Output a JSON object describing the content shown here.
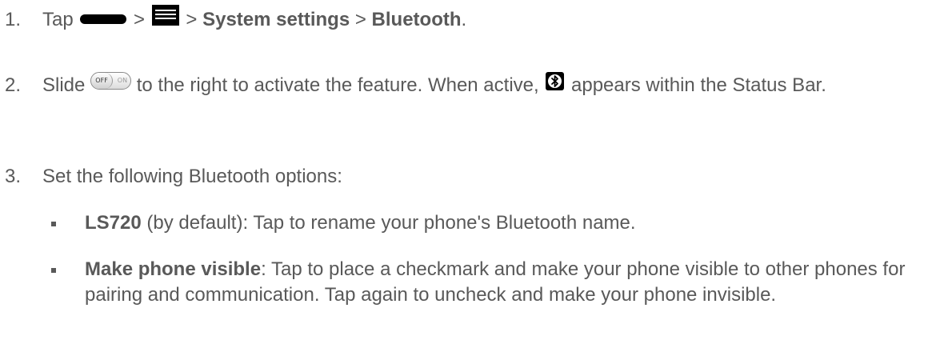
{
  "steps": [
    {
      "number": "1.",
      "tap": "Tap",
      "sep1": ">",
      "sep2": ">",
      "system_settings": "System settings",
      "sep3": ">",
      "bluetooth": "Bluetooth",
      "end": "."
    },
    {
      "number": "2.",
      "slide": "Slide",
      "after_toggle": "to the right to activate the feature. When active,",
      "after_icon": "appears within the Status Bar."
    },
    {
      "number": "3.",
      "text": "Set the following Bluetooth options:"
    }
  ],
  "toggle": {
    "off_label": "OFF",
    "on_label": "ON"
  },
  "options": [
    {
      "term": "LS720",
      "desc": " (by default): Tap to rename your phone's Bluetooth name."
    },
    {
      "term": "Make phone visible",
      "desc": ": Tap to place a checkmark and make your phone visible to other phones for pairing and communication. Tap again to uncheck and make your phone invisible."
    }
  ],
  "icons": {
    "home": "home-key-icon",
    "menu": "menu-key-icon",
    "toggle": "on-off-toggle-icon",
    "bluetooth": "bluetooth-status-icon"
  }
}
